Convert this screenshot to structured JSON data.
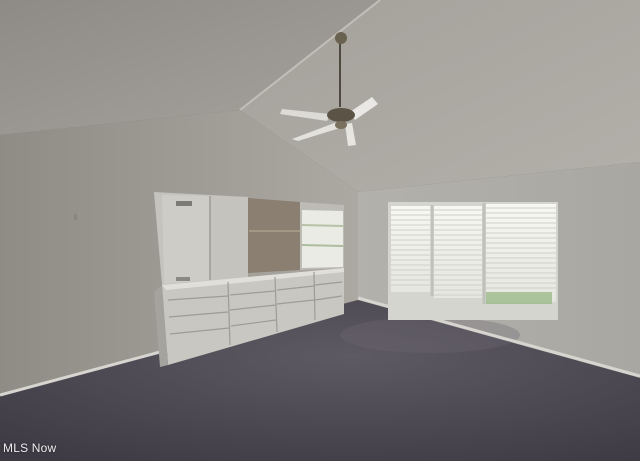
{
  "photo": {
    "subject": "empty-bedroom",
    "watermark": "MLS Now",
    "colors": {
      "wall": "#b9b5ad",
      "ceiling": "#a9a59f",
      "carpet": "#4d4954",
      "cabinet": "#c9c7c1",
      "window_light": "#f2f2ee",
      "fan_metal": "#5b5346"
    }
  }
}
